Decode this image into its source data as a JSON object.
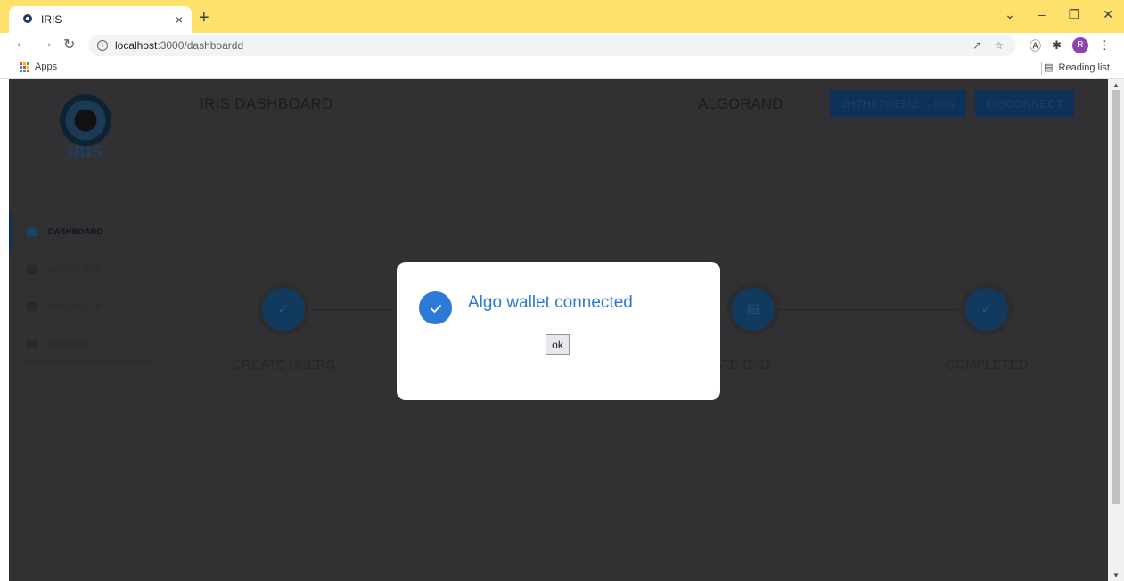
{
  "browser": {
    "tab_title": "IRIS",
    "tab_close": "×",
    "new_tab": "+",
    "url_host": "localhost",
    "url_path": ":3000/dashboardd",
    "apps_label": "Apps",
    "reading_list_label": "Reading list",
    "profile_initial": "R",
    "accent_color": "#fde16b"
  },
  "header": {
    "title": "IRIS DASHBOARD",
    "network": "ALGORAND",
    "wallet_button": "JHTHK7GEM2.... RIG",
    "disconnect_button": "DISCONNECT"
  },
  "logo": {
    "text": "IRIS"
  },
  "sidebar": {
    "items": [
      {
        "label": "DASHBOARD",
        "icon": "home-icon",
        "active": true
      },
      {
        "label": "CREATE KYC",
        "icon": "folder-icon",
        "active": false
      },
      {
        "label": "CREATE D-ID",
        "icon": "folder-icon",
        "active": false
      },
      {
        "label": "VIEW D-ID",
        "icon": "view-icon",
        "active": false
      }
    ]
  },
  "steps": [
    {
      "label": "CREATE USERS",
      "icon": "check-icon"
    },
    {
      "label": "REATE D-ID",
      "icon": "document-icon"
    },
    {
      "label": "COMPLETED",
      "icon": "check-circle-icon"
    }
  ],
  "modal": {
    "message": "Algo wallet connected",
    "ok_button": "ok",
    "accent_color": "#2d7ad6"
  }
}
